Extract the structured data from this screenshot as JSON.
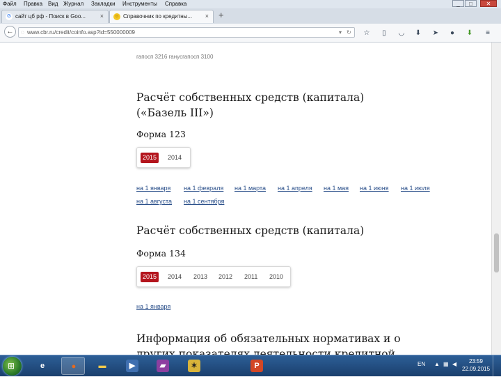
{
  "menu": {
    "items": [
      "Файл",
      "Правка",
      "Вид",
      "Журнал",
      "Закладки",
      "Инструменты",
      "Справка"
    ],
    "minimize": "_",
    "maximize": "□",
    "close": "✕"
  },
  "tabs": [
    {
      "title": "сайт цб рф - Поиск в Goo...",
      "favicon": "G",
      "close": "×"
    },
    {
      "title": "Справочник по кредитны...",
      "favicon": "☺",
      "close": "×"
    }
  ],
  "new_tab": "+",
  "url": "www.cbr.ru/credit/coinfo.asp?id=550000009",
  "faded_top": "гапосп 3216 ганусгапосп 3100",
  "sections": [
    {
      "title_lines": [
        "Расчёт собственных средств (капитала)",
        "(«Базель III»)"
      ],
      "form": "Форма 123",
      "years": [
        "2015",
        "2014"
      ],
      "dates": [
        "на 1 января",
        "на 1 февраля",
        "на 1 марта",
        "на 1 апреля",
        "на 1 мая",
        "на 1 июня",
        "на 1 июля",
        "на 1 августа",
        "на 1 сентября"
      ]
    },
    {
      "title_lines": [
        "Расчёт собственных средств (капитала)"
      ],
      "form": "Форма 134",
      "years": [
        "2015",
        "2014",
        "2013",
        "2012",
        "2011",
        "2010"
      ],
      "dates": [
        "на 1 января"
      ]
    },
    {
      "title_lines": [
        "Информация об обязательных нормативах и о",
        "других показателях деятельности кредитной"
      ]
    }
  ],
  "taskbar": {
    "apps": [
      {
        "icon": "ie-icon",
        "glyph": "e",
        "color": "#3a8fe0"
      },
      {
        "icon": "firefox-icon",
        "glyph": "●",
        "color": "#e76a1d"
      },
      {
        "icon": "folder-icon",
        "glyph": "▬",
        "color": "#f2c94c"
      },
      {
        "icon": "media-player-icon",
        "glyph": "▶",
        "color": "#3f6fb0"
      },
      {
        "icon": "winrar-icon",
        "glyph": "▰",
        "color": "#8d3fa0"
      },
      {
        "icon": "paint-icon",
        "glyph": "✶",
        "color": "#d9b43a"
      },
      {
        "icon": "powerpoint-icon",
        "glyph": "P",
        "color": "#d24726"
      }
    ],
    "language": "EN",
    "time": "23:59",
    "date": "22.09.2015"
  }
}
